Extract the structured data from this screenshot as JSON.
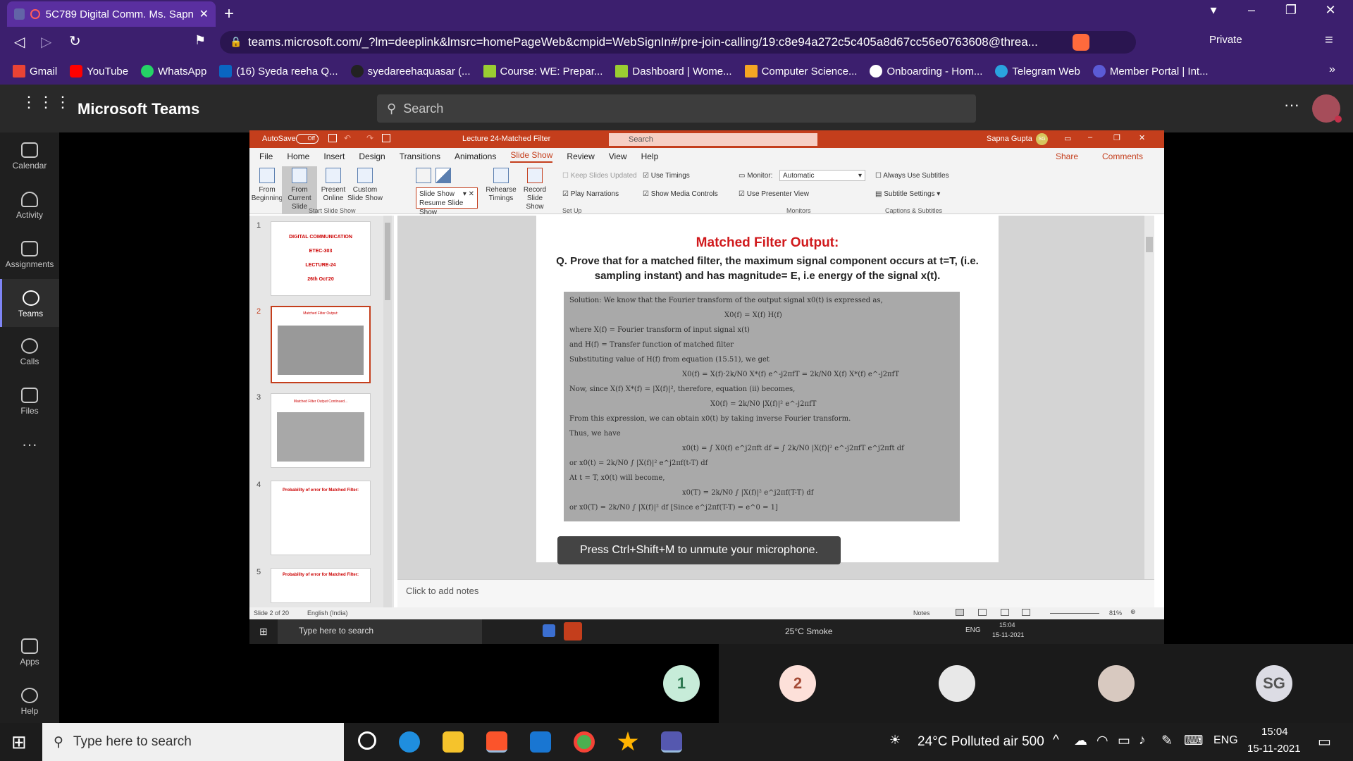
{
  "browser": {
    "tab_title": "5C789 Digital Comm. Ms. Sapn",
    "url": "teams.microsoft.com/_?lm=deeplink&lmsrc=homePageWeb&cmpid=WebSignIn#/pre-join-calling/19:c8e94a272c5c405a8d67cc56e0763608@threa...",
    "private_label": "Private",
    "bookmarks": [
      "Gmail",
      "YouTube",
      "WhatsApp",
      "(16) Syeda reeha Q...",
      "syedareehaquasar (...",
      "Course: WE: Prepar...",
      "Dashboard | Wome...",
      "Computer Science...",
      "Onboarding - Hom...",
      "Telegram Web",
      "Member Portal | Int..."
    ]
  },
  "teams": {
    "app_title": "Microsoft Teams",
    "search_placeholder": "Search",
    "rail": [
      "Calendar",
      "Activity",
      "Assignments",
      "Teams",
      "Calls",
      "Files",
      "Apps",
      "Help"
    ]
  },
  "ppt": {
    "autosave": "AutoSave",
    "autosave_state": "Off",
    "doc_title": "Lecture 24-Matched Filter",
    "search": "Search",
    "user": "Sapna Gupta",
    "user_initials": "SG",
    "tabs": [
      "File",
      "Home",
      "Insert",
      "Design",
      "Transitions",
      "Animations",
      "Slide Show",
      "Review",
      "View",
      "Help"
    ],
    "share": "Share",
    "comments": "Comments",
    "ribbon": {
      "from_beginning": "From Beginning",
      "from_current": "From Current Slide",
      "present_online": "Present Online",
      "custom_show": "Custom Slide Show",
      "slide_show_dd": "Slide Show",
      "resume": "Resume Slide Show",
      "rehearse": "Rehearse Timings",
      "record": "Record Slide Show",
      "keep_updated": "Keep Slides Updated",
      "play_narrations": "Play Narrations",
      "use_timings": "Use Timings",
      "show_media": "Show Media Controls",
      "monitor": "Monitor:",
      "monitor_value": "Automatic",
      "presenter_view": "Use Presenter View",
      "always_subtitles": "Always Use Subtitles",
      "subtitle_settings": "Subtitle Settings",
      "groups": [
        "Start Slide Show",
        "Set Up",
        "Monitors",
        "Captions & Subtitles"
      ]
    },
    "thumbs": [
      {
        "num": "1",
        "lines": [
          "DIGITAL COMMUNICATION",
          "ETEC-303",
          "LECTURE-24",
          "26th Oct'20"
        ]
      },
      {
        "num": "2",
        "lines": [
          "Matched Filter Output:"
        ]
      },
      {
        "num": "3",
        "lines": [
          "Matched Filter Output Continued..."
        ]
      },
      {
        "num": "4",
        "lines": [
          "Probability of error for Matched Filter:"
        ]
      },
      {
        "num": "5",
        "lines": [
          "Probability of error for Matched Filter:"
        ]
      }
    ],
    "slide": {
      "title": "Matched Filter Output:",
      "question": "Q. Prove that for a matched filter, the maximum signal component occurs at t=T, (i.e. sampling instant) and has magnitude= E, i.e energy of the signal x(t).",
      "photo_lines": [
        "Solution: We know that the Fourier transform of the output signal x0(t) is expressed as,",
        "X0(f) = X(f) H(f)",
        "where   X(f) = Fourier transform of input signal x(t)",
        "and   H(f) = Transfer function of matched filter",
        "Substituting value of H(f) from equation (15.51), we get",
        "X0(f) = X(f)·2k/N0 X*(f) e^-j2πfT = 2k/N0 X(f) X*(f) e^-j2πfT",
        "Now, since X(f) X*(f) = |X(f)|², therefore, equation (ii) becomes,",
        "X0(f) = 2k/N0 |X(f)|² e^-j2πfT",
        "From this expression, we can obtain x0(t) by taking inverse Fourier transform.",
        "Thus, we have",
        "x0(t) = ∫ X0(f) e^j2πft df = ∫ 2k/N0 |X(f)|² e^-j2πfT e^j2πft df",
        "or   x0(t) = 2k/N0 ∫ |X(f)|² e^j2πf(t-T) df",
        "At t = T, x0(t) will become,",
        "x0(T) = 2k/N0 ∫ |X(f)|² e^j2πf(T-T) df",
        "or   x0(T) = 2k/N0 ∫ |X(f)|² df   [Since e^j2πf(T-T) = e^0 = 1]"
      ]
    },
    "toast": "Press Ctrl+Shift+M to unmute your microphone.",
    "notes_placeholder": "Click to add notes",
    "status_slide": "Slide 2 of 20",
    "status_lang": "English (India)",
    "status_notes": "Notes",
    "zoom": "81%"
  },
  "inner_taskbar": {
    "search": "Type here to search",
    "weather": "25°C  Smoke",
    "lang": "ENG",
    "time": "15:04",
    "date": "15-11-2021"
  },
  "participants": [
    {
      "label": "1",
      "color": "#c7ecd9",
      "fg": "#2f7a52"
    },
    {
      "label": "2",
      "color": "#fde0d9",
      "fg": "#a44a36"
    },
    {
      "label": "",
      "color": "#e8e8e8",
      "fg": "#333"
    },
    {
      "label": "",
      "color": "#d8c9c0",
      "fg": "#333"
    },
    {
      "label": "SG",
      "color": "#dcdce4",
      "fg": "#555"
    }
  ],
  "taskbar": {
    "search": "Type here to search",
    "weather": "24°C  Polluted air 500",
    "lang": "ENG",
    "time": "15:04",
    "date": "15-11-2021"
  }
}
